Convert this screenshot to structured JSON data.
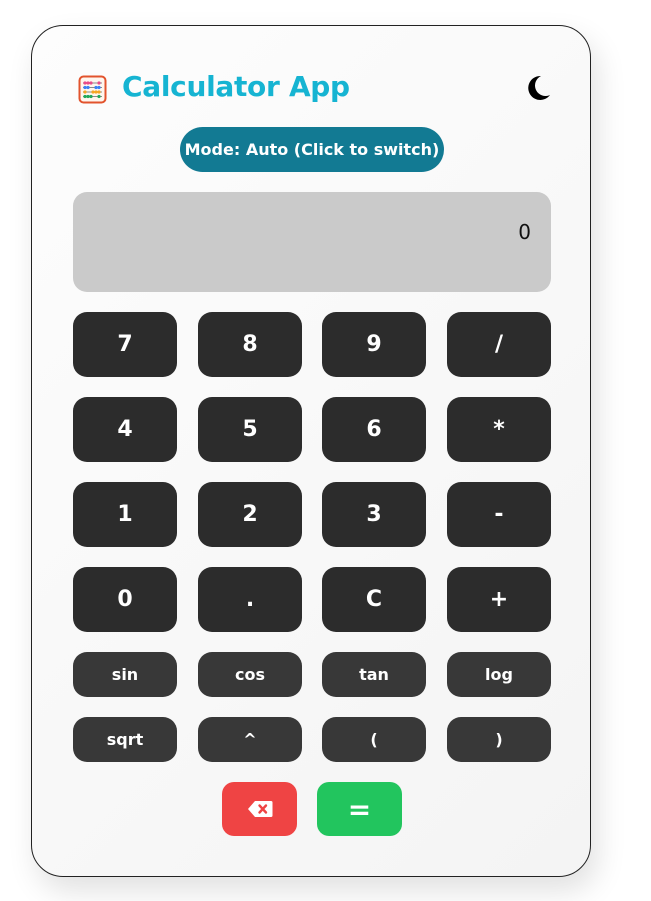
{
  "header": {
    "title": "Calculator App",
    "app_icon": "abacus-icon",
    "theme_icon": "moon-icon"
  },
  "mode": {
    "label": "Mode: Auto (Click to switch)"
  },
  "display": {
    "value": "0"
  },
  "keys": {
    "row1": [
      "7",
      "8",
      "9",
      "/"
    ],
    "row2": [
      "4",
      "5",
      "6",
      "*"
    ],
    "row3": [
      "1",
      "2",
      "3",
      "-"
    ],
    "row4": [
      "0",
      ".",
      "C",
      "+"
    ],
    "row5": [
      "sin",
      "cos",
      "tan",
      "log"
    ],
    "row6": [
      "sqrt",
      "^",
      "(",
      ")"
    ]
  },
  "actions": {
    "backspace_icon": "backspace-icon",
    "equals_label": "="
  },
  "colors": {
    "title": "#16b4d2",
    "mode_button": "#127a93",
    "display_bg": "#cacaca",
    "key_bg": "#2c2c2c",
    "function_key_bg": "#383838",
    "backspace_bg": "#ef4444",
    "equals_bg": "#22c55e"
  }
}
